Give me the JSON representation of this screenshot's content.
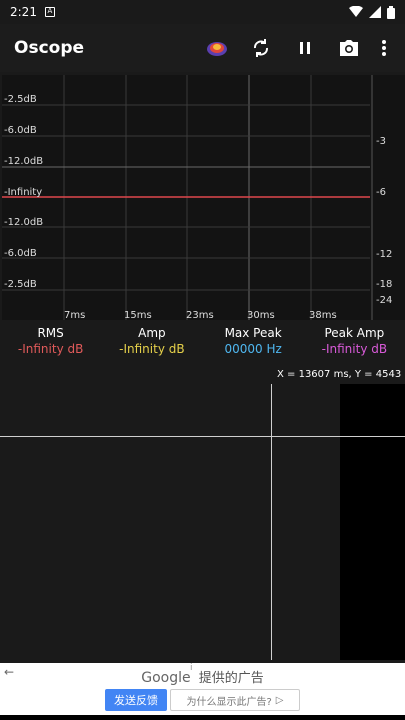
{
  "status": {
    "time": "2:21"
  },
  "appbar": {
    "title": "Oscope"
  },
  "icons": {
    "notification": "notification-icon",
    "wifi": "wifi-icon",
    "signal": "signal-icon",
    "battery": "battery-icon",
    "heatmap": "heatmap-icon",
    "sync": "sync-icon",
    "pause": "pause-icon",
    "camera": "camera-icon",
    "more": "more-vert-icon"
  },
  "scope": {
    "y_labels": [
      "-2.5dB",
      "-6.0dB",
      "-12.0dB",
      "-Infinity",
      "-12.0dB",
      "-6.0dB",
      "-2.5dB"
    ],
    "x_labels": [
      "7ms",
      "15ms",
      "23ms",
      "30ms",
      "38ms"
    ],
    "right_labels": [
      "-3",
      "-6",
      "-12",
      "-18",
      "-24"
    ],
    "trace_color": "#e0474c"
  },
  "stats": [
    {
      "label": "RMS",
      "value": "-Infinity dB",
      "color": "#e05a5a"
    },
    {
      "label": "Amp",
      "value": "-Infinity dB",
      "color": "#e5d04a"
    },
    {
      "label": "Max Peak",
      "value": "00000 Hz",
      "color": "#4fb7f0"
    },
    {
      "label": "Peak Amp",
      "value": "-Infinity dB",
      "color": "#d85ad8"
    }
  ],
  "spectrum": {
    "coord_readout": "X = 13607 ms, Y = 4543 Hz"
  },
  "ad": {
    "brand": "Google",
    "provided": "提供的广告",
    "feedback_button": "发送反馈",
    "why_button": "为什么显示此广告?",
    "info": "i"
  },
  "colors": {
    "grid": "#3a3a3a",
    "background": "#131313"
  }
}
